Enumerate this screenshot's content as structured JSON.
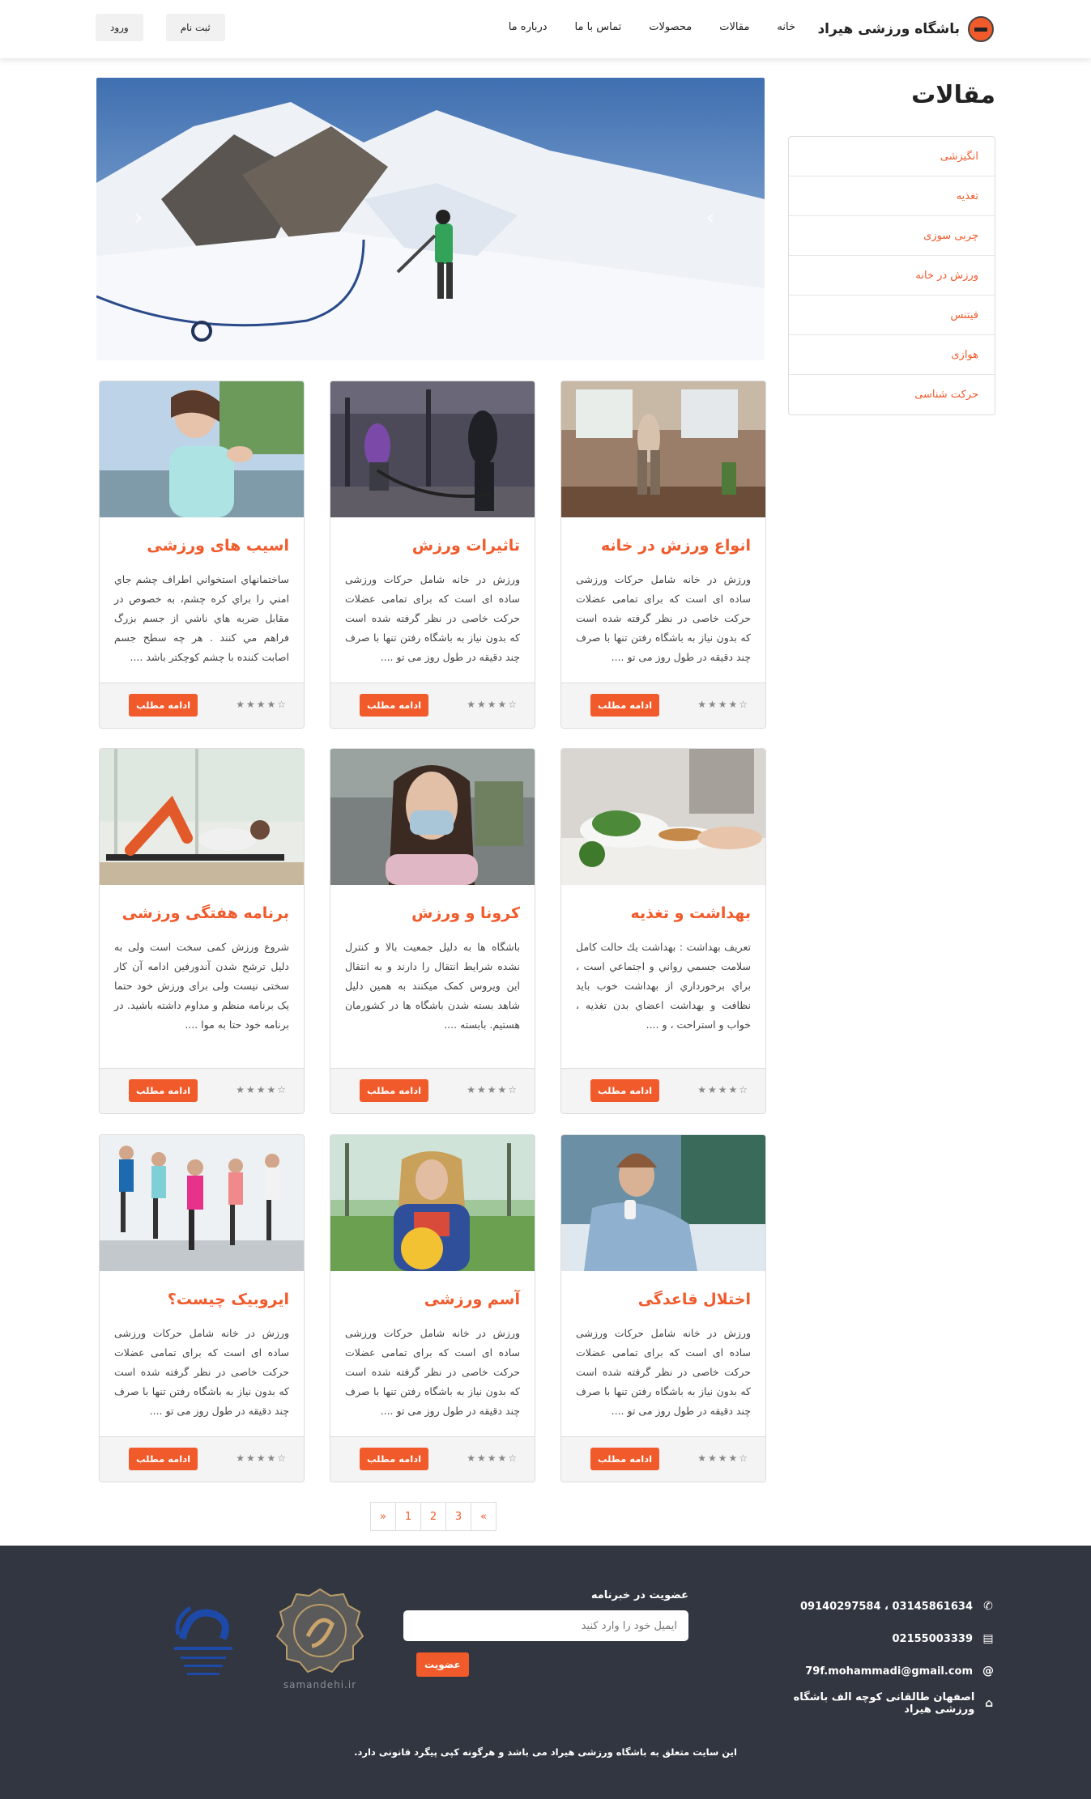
{
  "header": {
    "brand": "باشگاه ورزشی هیراد",
    "nav": [
      "خانه",
      "مقالات",
      "محصولات",
      "تماس با ما",
      "درباره ما"
    ],
    "login": "ورود",
    "register": "ثبت نام"
  },
  "sidebar": {
    "title": "مقالات",
    "items": [
      "انگیزشی",
      "تغذیه",
      "چربی سوزی",
      "ورزش در خانه",
      "فیتنس",
      "هوازی",
      "حرکت شناسی"
    ]
  },
  "slider": {
    "prev": "‹",
    "next": "›"
  },
  "cards": [
    {
      "title": "انواع ورزش در خانه",
      "text": "ورزش در خانه شامل حرکات ورزشی ساده ای است که برای تمامی عضلات حرکت خاصی در نظر گرفته شده است که بدون نیاز به باشگاه رفتن تنها با صرف چند دقیقه در طول روز می تو ....",
      "rating": "☆★★★★",
      "button": "ادامه مطلب"
    },
    {
      "title": "تاثیرات ورزش",
      "text": "ورزش در خانه شامل حرکات ورزشی ساده ای است که برای تمامی عضلات حرکت خاصی در نظر گرفته شده است که بدون نیاز به باشگاه رفتن تنها با صرف چند دقیقه در طول روز می تو ....",
      "rating": "☆★★★★",
      "button": "ادامه مطلب"
    },
    {
      "title": "اسیب های ورزشی",
      "text": "ساختمانهاي استخواني اطراف چشم جاي امني را براي كره چشم، به خصوص در مقابل ضربه هاي ناشي از جسم بزرگ فراهم مي كنند . هر چه سطح جسم اصابت كننده با چشم كوچكتر باشد ....",
      "rating": "☆★★★★",
      "button": "ادامه مطلب"
    },
    {
      "title": "بهداشت و تغذیه",
      "text": "تعریف بهداشت : بهداشت يك حالت كامل سلامت جسمي رواني و اجتماعي است ، براي برخورداري از بهداشت خوب بايد نظافت و بهداشت اعضاي بدن تغذيه ، خواب و استراحت ، و ....",
      "rating": "☆★★★★",
      "button": "ادامه مطلب"
    },
    {
      "title": "کرونا و ورزش",
      "text": "باشگاه ها به دلیل جمعیت بالا و کنترل نشده شرایط انتقال را دارند و به انتقال این ویروس کمک میکنند به همین دلیل شاهد بسته شدن باشگاه ها در کشورمان هستیم. بابسته ....",
      "rating": "☆★★★★",
      "button": "ادامه مطلب"
    },
    {
      "title": "برنامه هفتگی ورزشی",
      "text": "شروع ورزش کمی سخت است ولی به دلیل ترشح شدن آندورفین ادامه آن کار سختی نیست ولی برای ورزش خود حتما یک برنامه منظم و مداوم داشته باشید. در برنامه خود حتا به موا ....",
      "rating": "☆★★★★",
      "button": "ادامه مطلب"
    },
    {
      "title": "اختلال قاعدگی",
      "text": "ورزش در خانه شامل حرکات ورزشی ساده ای است که برای تمامی عضلات حرکت خاصی در نظر گرفته شده است که بدون نیاز به باشگاه رفتن تنها با صرف چند دقیقه در طول روز می تو ....",
      "rating": "☆★★★★",
      "button": "ادامه مطلب"
    },
    {
      "title": "آسم ورزشی",
      "text": "ورزش در خانه شامل حرکات ورزشی ساده ای است که برای تمامی عضلات حرکت خاصی در نظر گرفته شده است که بدون نیاز به باشگاه رفتن تنها با صرف چند دقیقه در طول روز می تو ....",
      "rating": "☆★★★★",
      "button": "ادامه مطلب"
    },
    {
      "title": "ایروبیک چیست؟",
      "text": "ورزش در خانه شامل حرکات ورزشی ساده ای است که برای تمامی عضلات حرکت خاصی در نظر گرفته شده است که بدون نیاز به باشگاه رفتن تنها با صرف چند دقیقه در طول روز می تو ....",
      "rating": "☆★★★★",
      "button": "ادامه مطلب"
    }
  ],
  "pagination": [
    "«",
    "1",
    "2",
    "3",
    "»"
  ],
  "footer": {
    "phones": "09140297584 ، 03145861634",
    "fax": "02155003339",
    "email": "79f.mohammadi@gmail.com",
    "address": "اصفهان طالقانی کوچه الف باشگاه ورزشی هیراد",
    "newsletter_title": "عضویت در خبرنامه",
    "newsletter_placeholder": "ایمیل خود را وارد کنید",
    "newsletter_button": "عضویت",
    "samandehi_text": "samandehi.ir",
    "copyright": "این سایت متعلق به باشگاه ورزشی هیراد می باشد و هرگونه کپی پیگرد قانونی دارد."
  },
  "colors": {
    "accent": "#f15a2b",
    "footer_bg": "#323640"
  }
}
